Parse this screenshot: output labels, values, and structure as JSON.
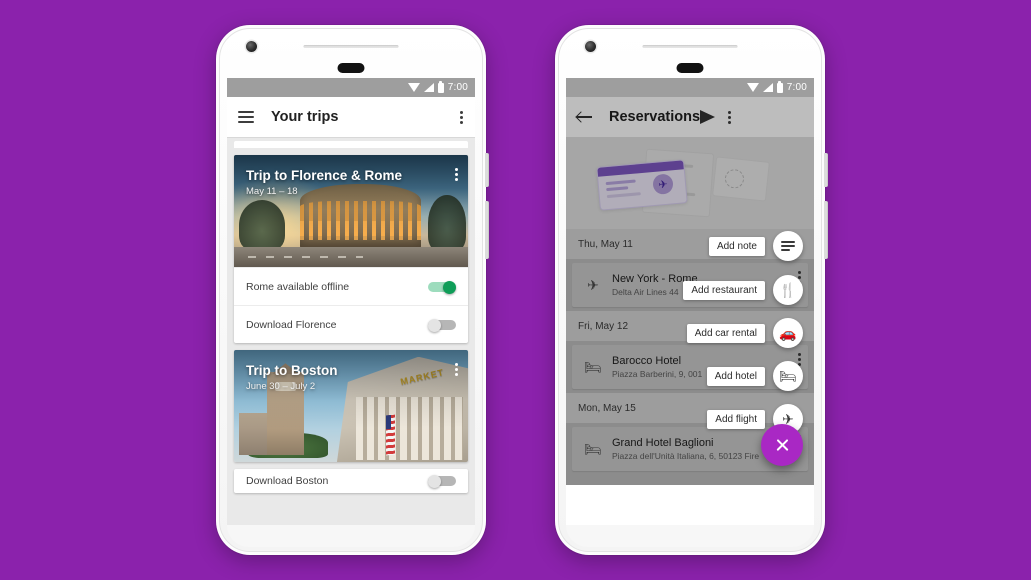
{
  "background_color": "#8B22AC",
  "left_phone": {
    "status_bar": {
      "time": "7:00",
      "icons": [
        "wifi-icon",
        "signal-icon",
        "battery-icon"
      ]
    },
    "app_bar": {
      "menu_icon": "hamburger-menu-icon",
      "title": "Your trips",
      "overflow_icon": "overflow-menu-icon"
    },
    "trips": [
      {
        "title": "Trip to Florence & Rome",
        "dates": "May 11 – 18",
        "photo": "colosseum-rome-sunset",
        "overflow_icon": "overflow-menu-icon",
        "toggles": [
          {
            "label": "Rome available offline",
            "state": "on",
            "color": "#0f9d58"
          },
          {
            "label": "Download Florence",
            "state": "off",
            "color": "#b6b6b6"
          }
        ]
      },
      {
        "title": "Trip to Boston",
        "dates": "June 30 – July 2",
        "photo": "boston-quincy-market",
        "overflow_icon": "overflow-menu-icon",
        "toggles": [
          {
            "label": "Download Boston",
            "state": "off",
            "color": "#b6b6b6"
          }
        ]
      }
    ]
  },
  "right_phone": {
    "status_bar": {
      "time": "7:00",
      "icons": [
        "wifi-icon",
        "signal-icon",
        "battery-icon"
      ]
    },
    "app_bar": {
      "back_icon": "back-arrow-icon",
      "title": "Reservations",
      "send_icon": "send-icon",
      "overflow_icon": "overflow-menu-icon"
    },
    "hero_illustration": "boarding-pass-illustration",
    "days": [
      {
        "label": "Thu, May 11",
        "items": [
          {
            "icon": "flight-icon",
            "title": "New York - Rome",
            "subtitle": "Delta Air Lines 44",
            "overflow_icon": "overflow-menu-icon"
          }
        ]
      },
      {
        "label": "Fri, May 12",
        "items": [
          {
            "icon": "hotel-icon",
            "title": "Barocco Hotel",
            "subtitle": "Piazza Barberini, 9, 001",
            "overflow_icon": "overflow-menu-icon"
          }
        ]
      },
      {
        "label": "Mon, May 15",
        "items": [
          {
            "icon": "hotel-icon",
            "title": "Grand Hotel Baglioni",
            "subtitle": "Piazza dell'Unità Italiana, 6, 50123 Fire",
            "overflow_icon": "overflow-menu-icon"
          }
        ]
      }
    ],
    "speed_dial": {
      "expanded": true,
      "fab": {
        "icon": "close-icon",
        "color": "#a928c4"
      },
      "actions": [
        {
          "label": "Add note",
          "icon": "note-icon"
        },
        {
          "label": "Add restaurant",
          "icon": "restaurant-icon"
        },
        {
          "label": "Add car rental",
          "icon": "car-icon"
        },
        {
          "label": "Add hotel",
          "icon": "hotel-icon"
        },
        {
          "label": "Add flight",
          "icon": "flight-icon"
        }
      ]
    }
  }
}
